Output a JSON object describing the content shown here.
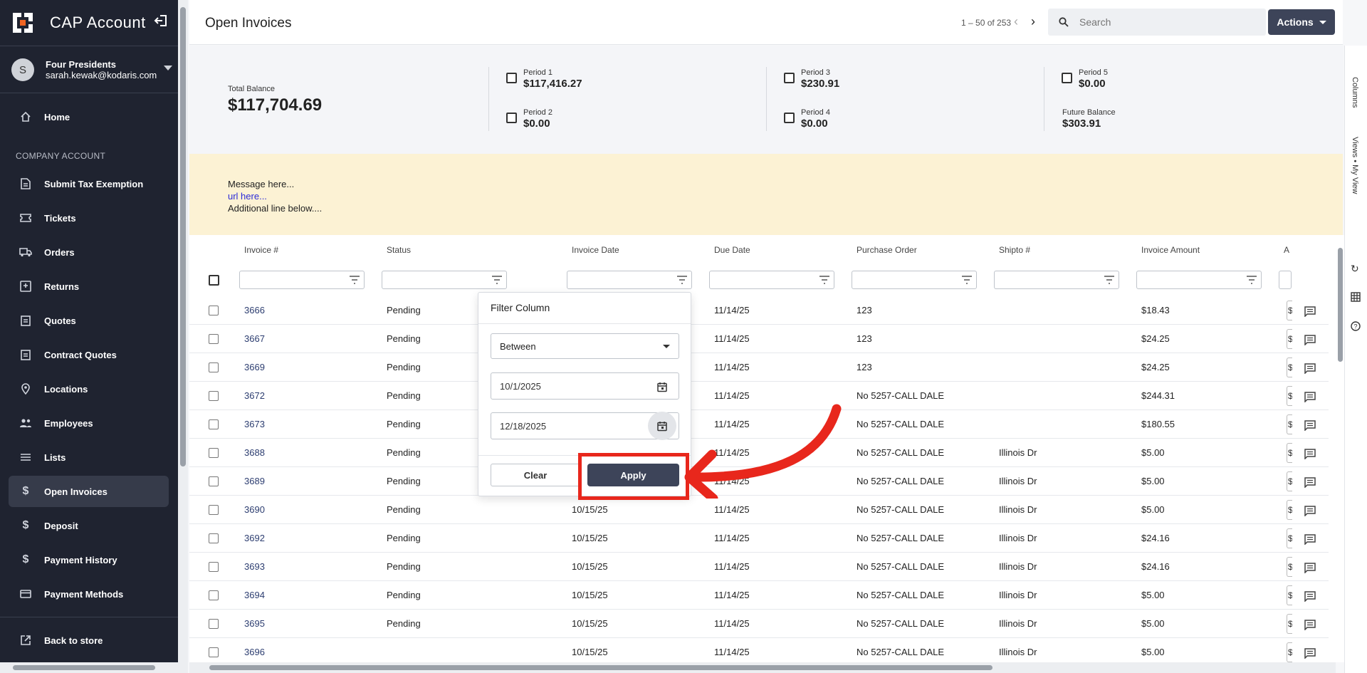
{
  "app": {
    "title": "CAP Account",
    "user_name": "Four Presidents",
    "user_email": "sarah.kewak@kodaris.com",
    "user_initial": "S"
  },
  "sidebar": {
    "home": "Home",
    "section": "COMPANY ACCOUNT",
    "items": [
      {
        "label": "Submit Tax Exemption",
        "icon": "document-icon"
      },
      {
        "label": "Tickets",
        "icon": "ticket-icon"
      },
      {
        "label": "Orders",
        "icon": "truck-icon"
      },
      {
        "label": "Returns",
        "icon": "return-icon"
      },
      {
        "label": "Quotes",
        "icon": "clipboard-icon"
      },
      {
        "label": "Contract Quotes",
        "icon": "clipboard-icon"
      },
      {
        "label": "Locations",
        "icon": "pin-icon"
      },
      {
        "label": "Employees",
        "icon": "people-icon"
      },
      {
        "label": "Lists",
        "icon": "list-icon"
      },
      {
        "label": "Open Invoices",
        "icon": "dollar-icon"
      },
      {
        "label": "Deposit",
        "icon": "dollar-icon"
      },
      {
        "label": "Payment History",
        "icon": "dollar-icon"
      },
      {
        "label": "Payment Methods",
        "icon": "card-icon"
      }
    ],
    "back": "Back to store"
  },
  "header": {
    "title": "Open Invoices",
    "pager": "1 – 50 of 253",
    "search_placeholder": "Search",
    "actions": "Actions"
  },
  "balances": {
    "total_label": "Total Balance",
    "total_value": "$117,704.69",
    "p1_label": "Period 1",
    "p1_value": "$117,416.27",
    "p2_label": "Period 2",
    "p2_value": "$0.00",
    "p3_label": "Period 3",
    "p3_value": "$230.91",
    "p4_label": "Period 4",
    "p4_value": "$0.00",
    "p5_label": "Period 5",
    "p5_value": "$0.00",
    "future_label": "Future Balance",
    "future_value": "$303.91"
  },
  "message": {
    "line1": "Message here...",
    "url": "url here...",
    "line2": "Additional line below...."
  },
  "grid": {
    "columns": [
      "Invoice #",
      "Status",
      "Invoice Date",
      "Due Date",
      "Purchase Order",
      "Shipto #",
      "Invoice Amount",
      "A"
    ],
    "rows": [
      [
        "3666",
        "Pending",
        "",
        "11/14/25",
        "123",
        "",
        "$18.43"
      ],
      [
        "3667",
        "Pending",
        "",
        "11/14/25",
        "123",
        "",
        "$24.25"
      ],
      [
        "3669",
        "Pending",
        "",
        "11/14/25",
        "123",
        "",
        "$24.25"
      ],
      [
        "3672",
        "Pending",
        "",
        "11/14/25",
        "No 5257-CALL DALE",
        "",
        "$244.31"
      ],
      [
        "3673",
        "Pending",
        "",
        "11/14/25",
        "No 5257-CALL DALE",
        "",
        "$180.55"
      ],
      [
        "3688",
        "Pending",
        "",
        "11/14/25",
        "No 5257-CALL DALE",
        "Illinois Dr",
        "$5.00"
      ],
      [
        "3689",
        "Pending",
        "",
        "11/14/25",
        "No 5257-CALL DALE",
        "Illinois Dr",
        "$5.00"
      ],
      [
        "3690",
        "Pending",
        "10/15/25",
        "11/14/25",
        "No 5257-CALL DALE",
        "Illinois Dr",
        "$5.00"
      ],
      [
        "3692",
        "Pending",
        "10/15/25",
        "11/14/25",
        "No 5257-CALL DALE",
        "Illinois Dr",
        "$24.16"
      ],
      [
        "3693",
        "Pending",
        "10/15/25",
        "11/14/25",
        "No 5257-CALL DALE",
        "Illinois Dr",
        "$24.16"
      ],
      [
        "3694",
        "Pending",
        "10/15/25",
        "11/14/25",
        "No 5257-CALL DALE",
        "Illinois Dr",
        "$5.00"
      ],
      [
        "3695",
        "Pending",
        "10/15/25",
        "11/14/25",
        "No 5257-CALL DALE",
        "Illinois Dr",
        "$5.00"
      ],
      [
        "3696",
        "",
        "10/15/25",
        "11/14/25",
        "No 5257-CALL DALE",
        "Illinois Dr",
        "$5.00"
      ]
    ]
  },
  "filter_popup": {
    "title": "Filter Column",
    "operator": "Between",
    "from": "10/1/2025",
    "to": "12/18/2025",
    "clear": "Clear",
    "apply": "Apply"
  },
  "right_rail": {
    "columns": "Columns",
    "views": "Views • My View"
  },
  "colors": {
    "sidebar_bg": "#1f2330",
    "accent": "#3d4459",
    "highlight": "#e8271c",
    "message_bg": "#fcf2d4"
  }
}
